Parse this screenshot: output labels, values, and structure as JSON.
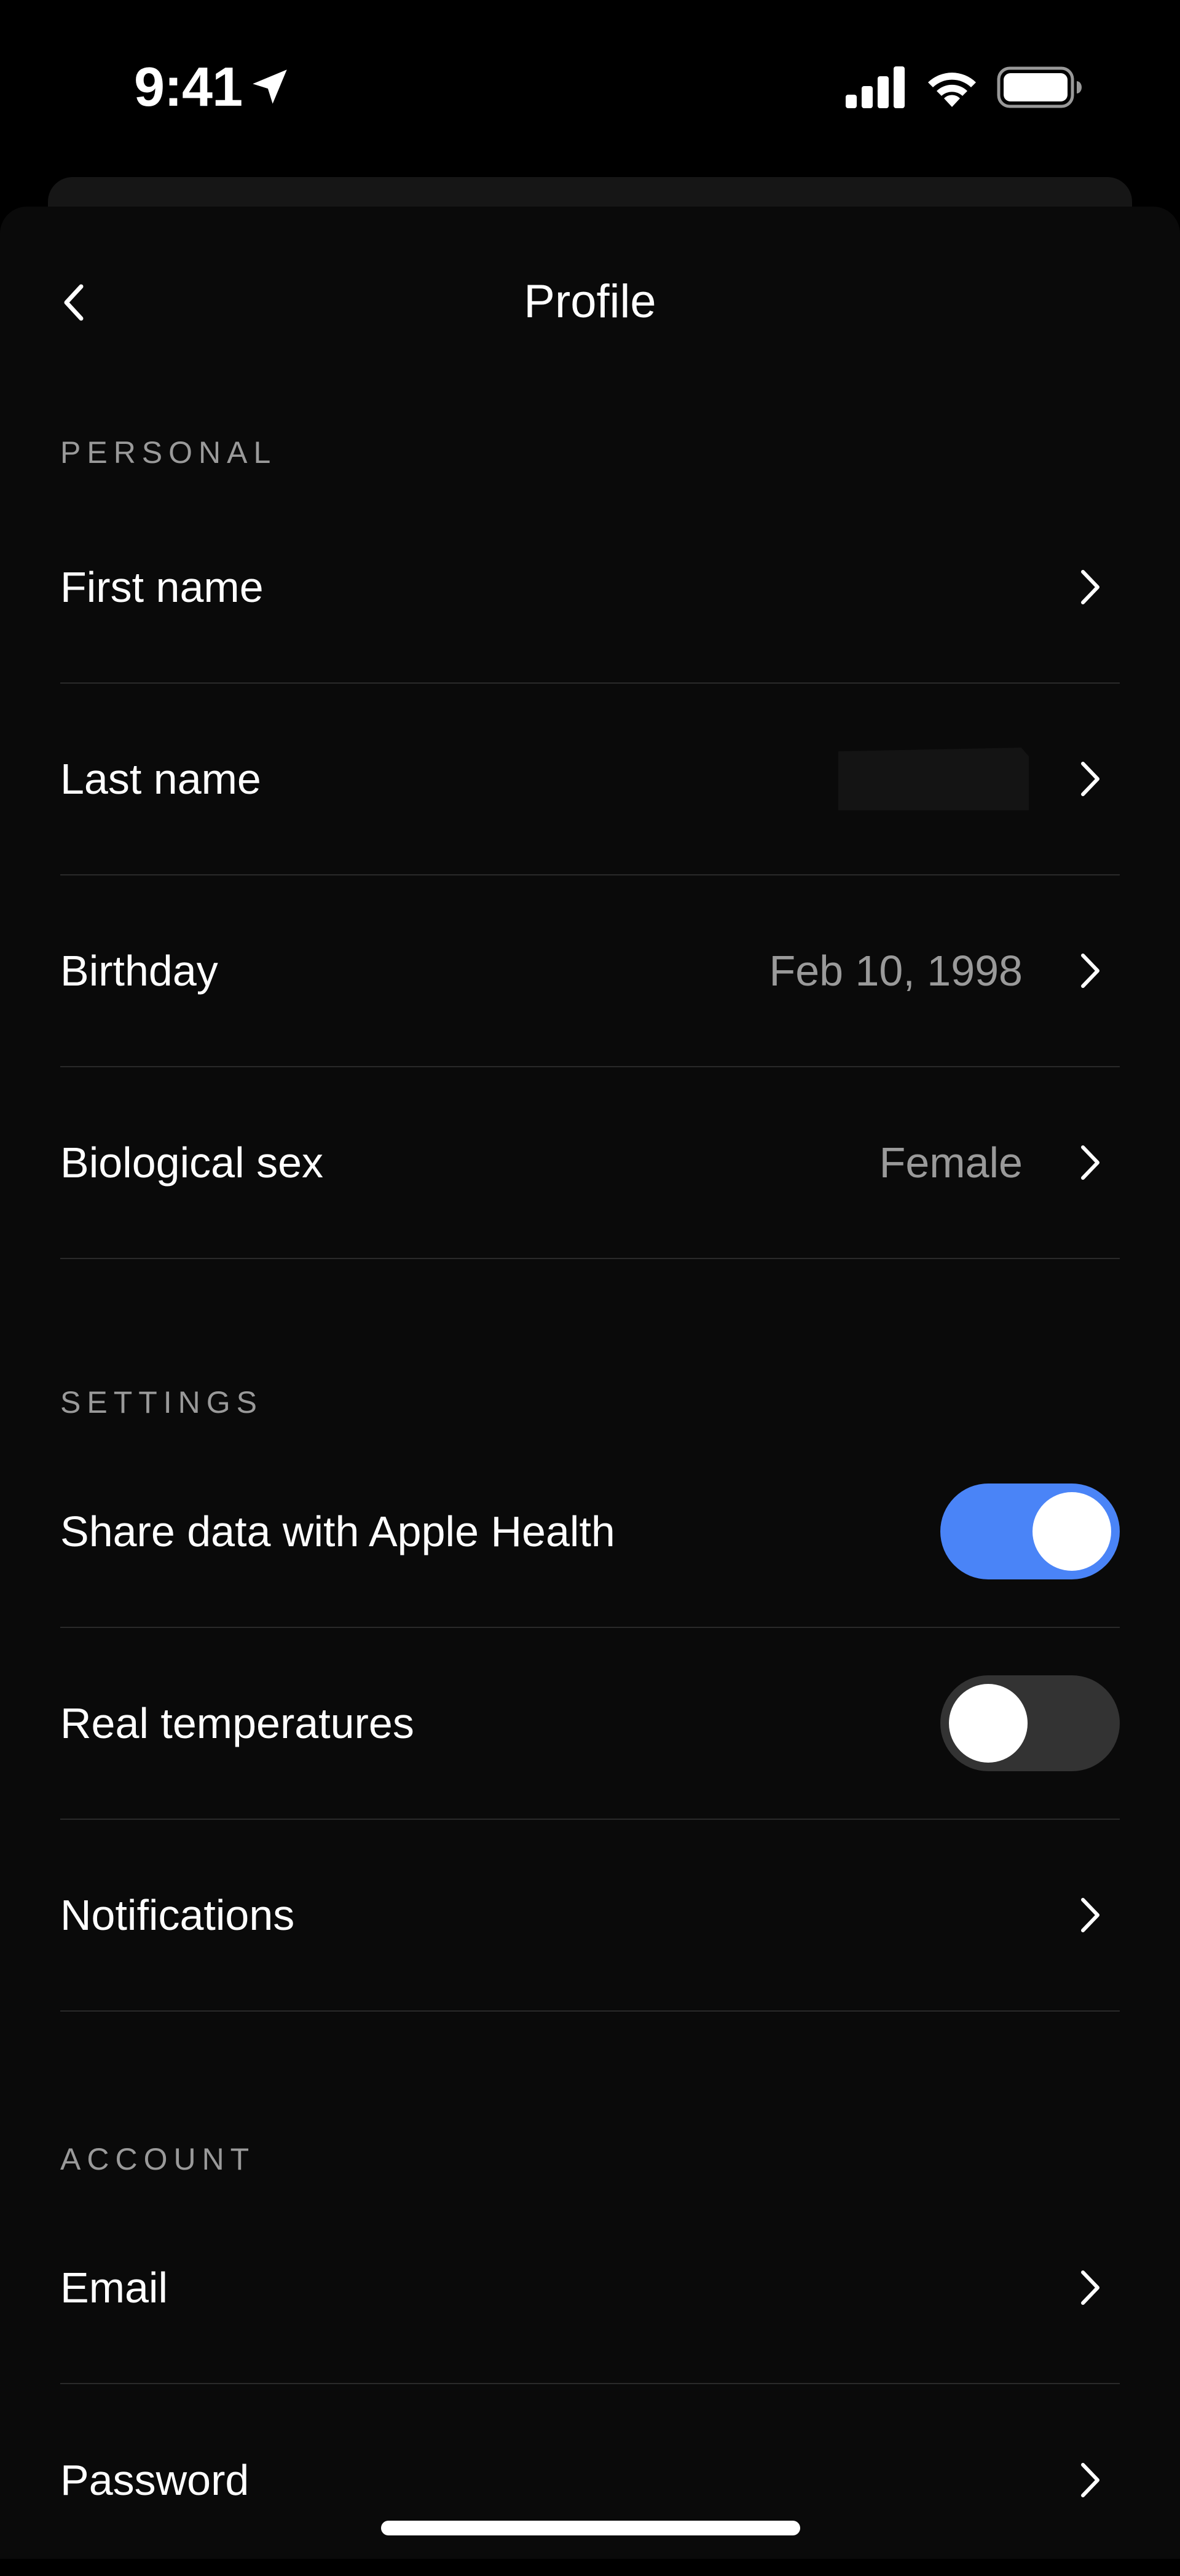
{
  "status_bar": {
    "time": "9:41",
    "icons": [
      "location-arrow-icon",
      "cellular-signal-icon",
      "wifi-icon",
      "battery-icon"
    ]
  },
  "nav": {
    "title": "Profile",
    "back_icon": "chevron-left-icon"
  },
  "sections": {
    "personal": {
      "header": "PERSONAL",
      "rows": [
        {
          "label": "First name",
          "value": ""
        },
        {
          "label": "Last name",
          "value": ""
        },
        {
          "label": "Birthday",
          "value": "Feb 10, 1998"
        },
        {
          "label": "Biological sex",
          "value": "Female"
        }
      ]
    },
    "settings": {
      "header": "SETTINGS",
      "rows": [
        {
          "label": "Share data with Apple Health",
          "toggle": true
        },
        {
          "label": "Real temperatures",
          "toggle": false
        },
        {
          "label": "Notifications"
        }
      ]
    },
    "account": {
      "header": "ACCOUNT",
      "rows": [
        {
          "label": "Email",
          "value": ""
        },
        {
          "label": "Password",
          "value": ""
        }
      ]
    }
  },
  "colors": {
    "background": "#0a0a0a",
    "accent": "#4a84f7",
    "secondary_text": "#9a9a9a",
    "divider": "#2a2a2a"
  }
}
